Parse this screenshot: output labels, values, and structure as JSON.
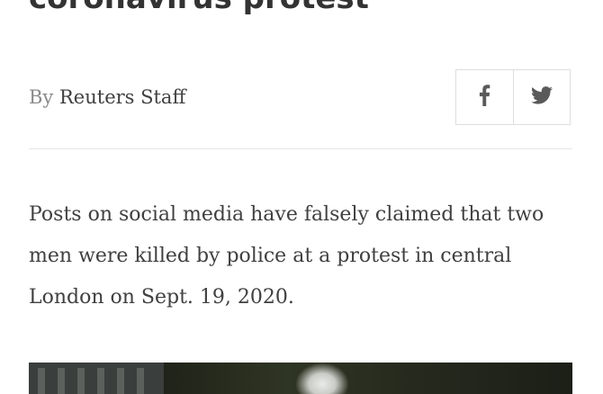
{
  "article": {
    "headline_partial": "coronavirus protest",
    "byline": {
      "prefix": "By",
      "author": "Reuters Staff"
    },
    "share": {
      "facebook_icon": "facebook-icon",
      "twitter_icon": "twitter-icon"
    },
    "lede": "Posts on social media have falsely claimed that two men were killed by police at a protest in central London on Sept. 19, 2020."
  },
  "colors": {
    "text": "#404040",
    "muted": "#8a8a8a",
    "border": "#dedede",
    "icon": "#5a5a5a"
  }
}
